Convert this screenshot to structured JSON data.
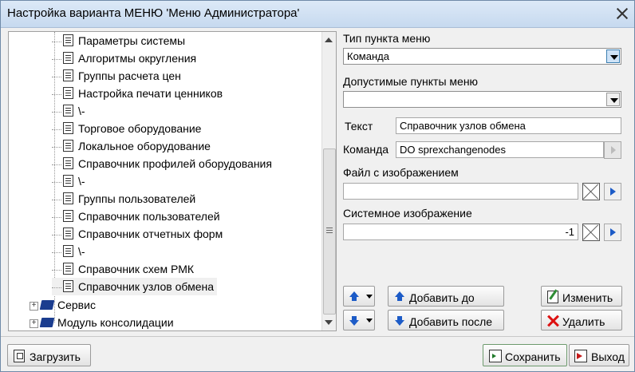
{
  "window": {
    "title": "Настройка варианта МЕНЮ 'Меню Администратора'"
  },
  "tree": {
    "items": [
      {
        "label": "Параметры системы"
      },
      {
        "label": "Алгоритмы округления"
      },
      {
        "label": "Группы расчета цен"
      },
      {
        "label": "Настройка печати ценников"
      },
      {
        "label": "\\-"
      },
      {
        "label": "Торговое оборудование"
      },
      {
        "label": "Локальное  оборудование"
      },
      {
        "label": "Справочник профилей оборудования"
      },
      {
        "label": "\\-"
      },
      {
        "label": "Группы пользователей"
      },
      {
        "label": "Справочник пользователей"
      },
      {
        "label": "Справочник отчетных форм"
      },
      {
        "label": "\\-"
      },
      {
        "label": "Справочник схем РМК"
      },
      {
        "label": "Справочник узлов обмена",
        "selected": true
      }
    ],
    "folders": [
      {
        "label": "Сервис"
      },
      {
        "label": "Модуль консолидации"
      }
    ]
  },
  "form": {
    "menu_type_label": "Тип пункта меню",
    "menu_type_value": "Команда",
    "allowed_items_label": "Допустимые пункты меню",
    "allowed_items_value": "",
    "text_label": "Текст",
    "text_value": "Справочник узлов обмена",
    "command_label": "Команда",
    "command_value": "DO sprexchangenodes",
    "image_file_label": "Файл с изображением",
    "image_file_value": "",
    "system_image_label": "Системное изображение",
    "system_image_value": "-1"
  },
  "buttons": {
    "add_before": "Добавить до",
    "add_after": "Добавить после",
    "edit": "Изменить",
    "delete": "Удалить",
    "load": "Загрузить",
    "save": "Сохранить",
    "exit": "Выход"
  }
}
